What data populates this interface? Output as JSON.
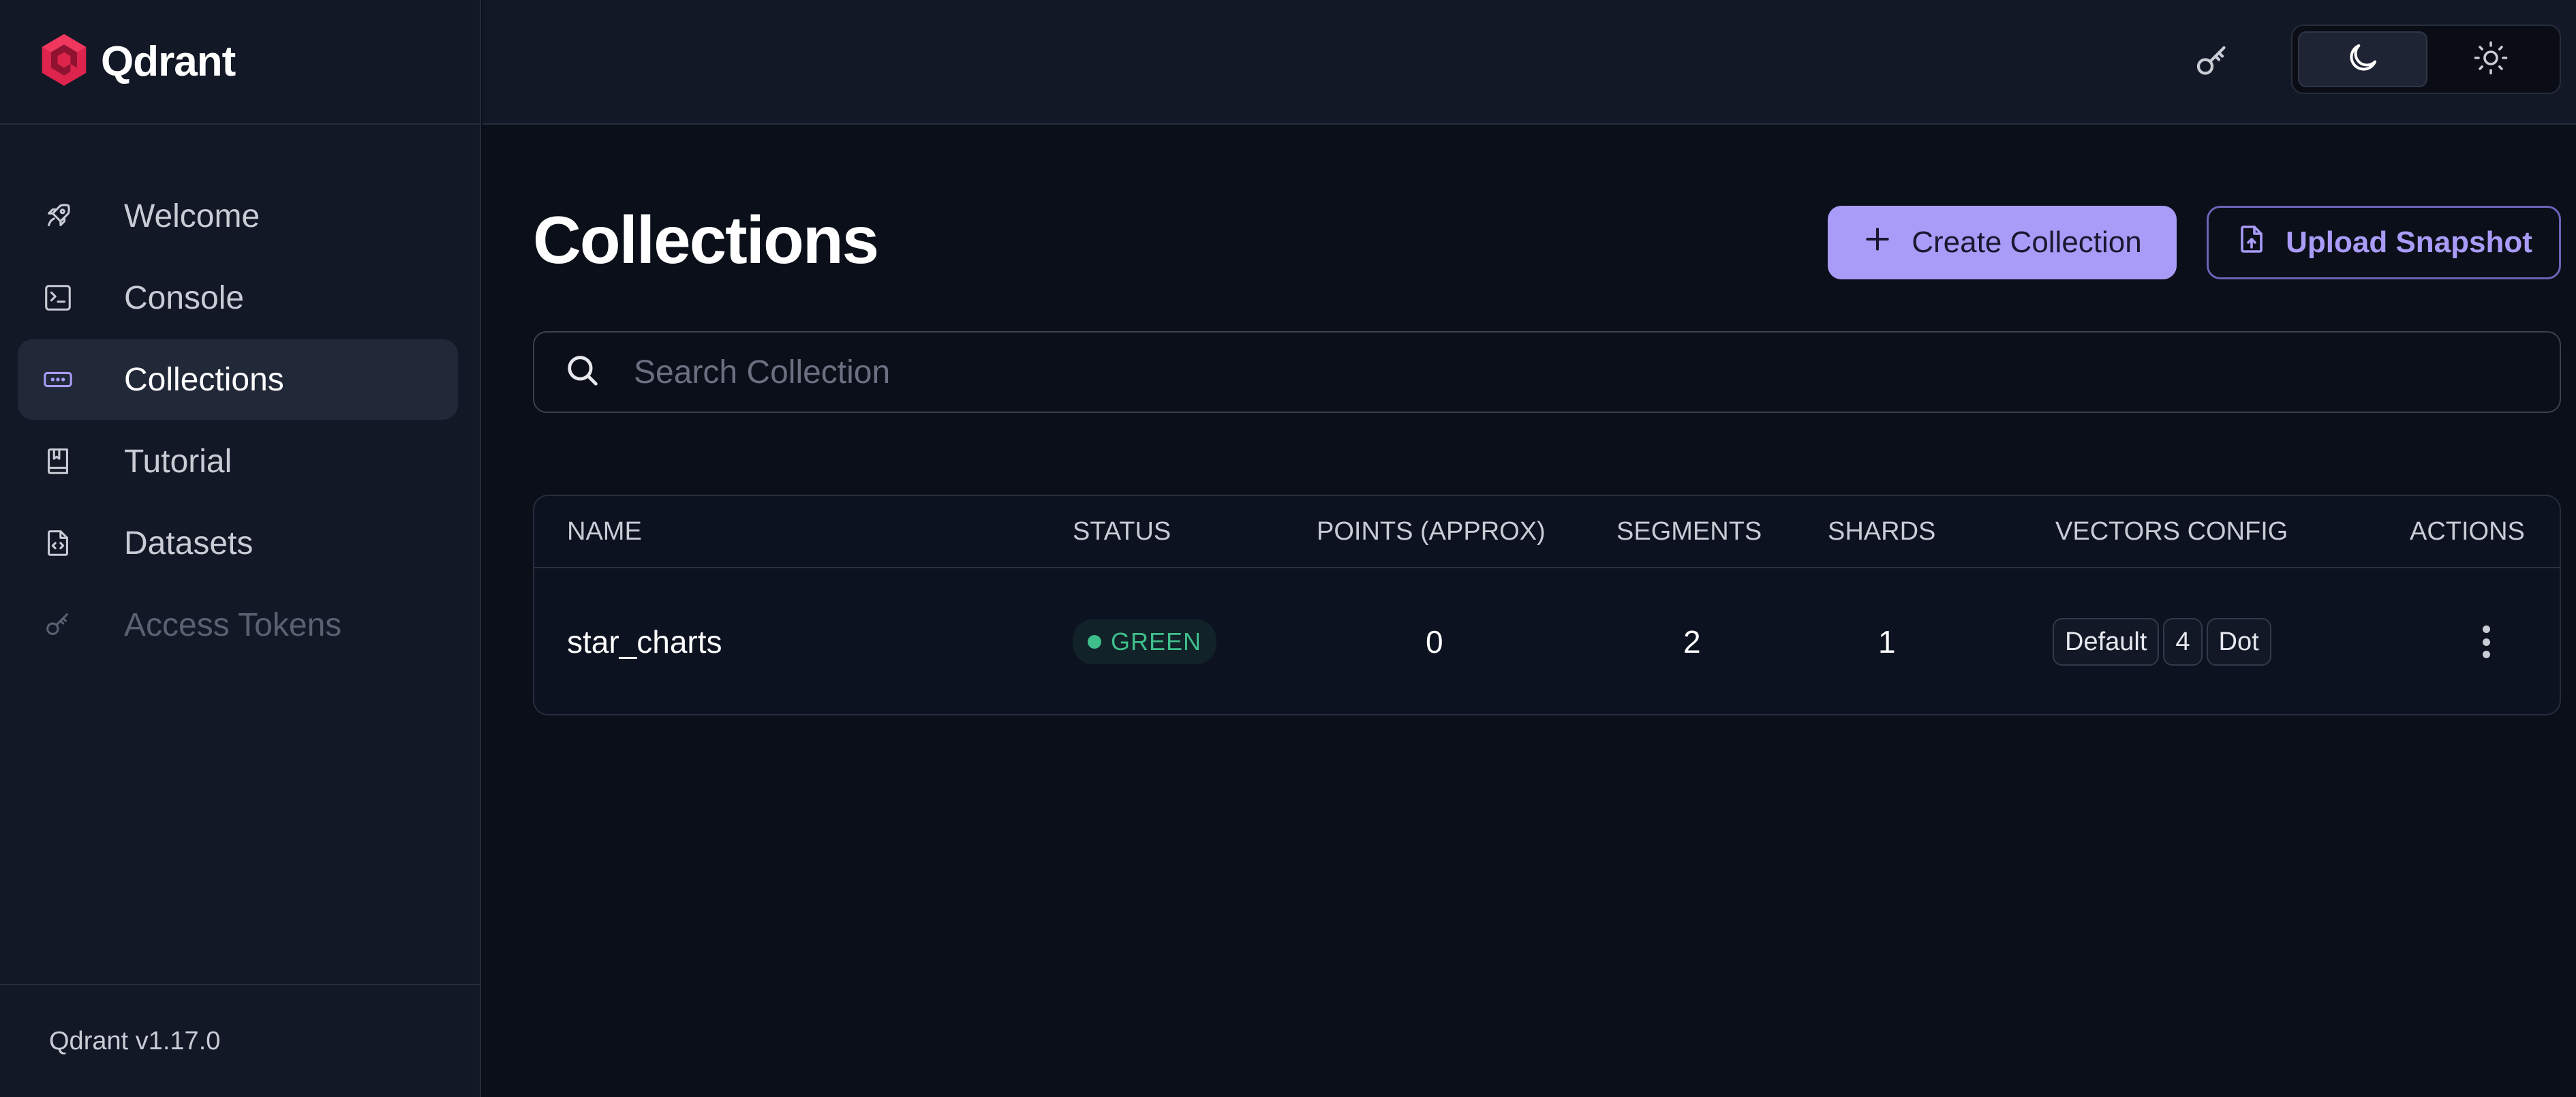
{
  "brand": {
    "name": "Qdrant",
    "logo_icon": "qdrant-logo-icon",
    "accent": "#dc244c"
  },
  "sidebar": {
    "items": [
      {
        "label": "Welcome",
        "icon": "rocket-icon",
        "active": false,
        "disabled": false
      },
      {
        "label": "Console",
        "icon": "terminal-icon",
        "active": false,
        "disabled": false
      },
      {
        "label": "Collections",
        "icon": "collections-icon",
        "active": true,
        "disabled": false
      },
      {
        "label": "Tutorial",
        "icon": "book-icon",
        "active": false,
        "disabled": false
      },
      {
        "label": "Datasets",
        "icon": "file-code-icon",
        "active": false,
        "disabled": false
      },
      {
        "label": "Access Tokens",
        "icon": "key-icon",
        "active": false,
        "disabled": true
      }
    ],
    "version": "Qdrant v1.17.0"
  },
  "header": {
    "api_key_icon": "key-icon",
    "theme": {
      "options": [
        "dark",
        "light"
      ],
      "selected": "dark"
    }
  },
  "main": {
    "title": "Collections",
    "create_button": "Create Collection",
    "upload_button": "Upload Snapshot",
    "search": {
      "placeholder": "Search Collection",
      "value": ""
    },
    "table": {
      "columns": [
        "NAME",
        "STATUS",
        "POINTS (APPROX)",
        "SEGMENTS",
        "SHARDS",
        "VECTORS CONFIG",
        "ACTIONS"
      ],
      "rows": [
        {
          "name": "star_charts",
          "status": "GREEN",
          "status_color": "#3fbf8c",
          "points": "0",
          "segments": "2",
          "shards": "1",
          "vectors_config": [
            "Default",
            "4",
            "Dot"
          ]
        }
      ]
    }
  },
  "colors": {
    "accent": "#a99cf8",
    "background": "#0b0f19",
    "sidebar": "#121826"
  }
}
